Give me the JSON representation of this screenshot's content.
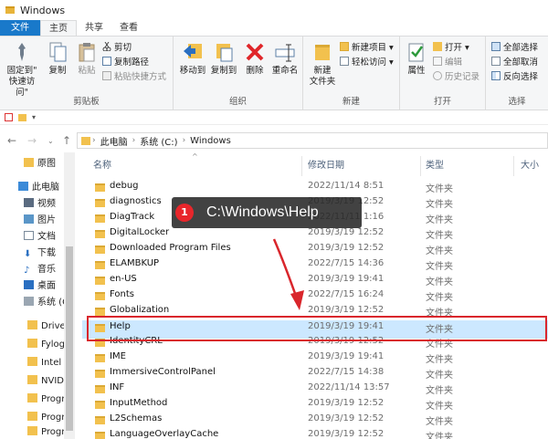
{
  "window": {
    "title": "Windows"
  },
  "ribbon_tabs": [
    "文件",
    "主页",
    "共享",
    "查看"
  ],
  "ribbon": {
    "clipboard": {
      "label": "剪贴板",
      "pin": "固定到\"\n快速访问\"",
      "copy": "复制",
      "paste": "粘贴",
      "cut": "剪切",
      "copy_path": "复制路径",
      "paste_shortcut": "粘贴快捷方式"
    },
    "organize": {
      "label": "组织",
      "move_to": "移动到",
      "copy_to": "复制到",
      "delete": "删除",
      "rename": "重命名"
    },
    "new": {
      "label": "新建",
      "new_folder": "新建\n文件夹",
      "new_item": "新建项目",
      "easy_access": "轻松访问"
    },
    "open": {
      "label": "打开",
      "properties": "属性",
      "open": "打开",
      "edit": "编辑",
      "history": "历史记录"
    },
    "select": {
      "label": "选择",
      "select_all": "全部选择",
      "select_none": "全部取消",
      "invert": "反向选择"
    }
  },
  "address": {
    "crumbs": [
      "此电脑",
      "系统 (C:)",
      "Windows"
    ]
  },
  "nav_items": [
    {
      "label": "原图",
      "icon": "folder-icon"
    },
    {
      "label": "此电脑",
      "icon": "computer-icon"
    },
    {
      "label": "视频",
      "icon": "video-icon"
    },
    {
      "label": "图片",
      "icon": "picture-icon"
    },
    {
      "label": "文档",
      "icon": "document-icon"
    },
    {
      "label": "下载",
      "icon": "download-icon"
    },
    {
      "label": "音乐",
      "icon": "music-icon"
    },
    {
      "label": "桌面",
      "icon": "desktop-icon"
    },
    {
      "label": "系统 (C",
      "icon": "drive-icon"
    },
    {
      "label": "Drive",
      "icon": "folder-icon"
    },
    {
      "label": "Fylog",
      "icon": "folder-icon"
    },
    {
      "label": "Intel",
      "icon": "folder-icon"
    },
    {
      "label": "NVIDI",
      "icon": "folder-icon"
    },
    {
      "label": "Progr",
      "icon": "folder-icon"
    },
    {
      "label": "Progr",
      "icon": "folder-icon"
    },
    {
      "label": "Progr",
      "icon": "folder-icon"
    }
  ],
  "columns": {
    "name": "名称",
    "date": "修改日期",
    "type": "类型",
    "size": "大小"
  },
  "files": [
    {
      "name": "debug",
      "date": "2022/11/14 8:51",
      "type": "文件夹"
    },
    {
      "name": "diagnostics",
      "date": "2019/3/19 12:52",
      "type": "文件夹"
    },
    {
      "name": "DiagTrack",
      "date": "2022/11/11 1:16",
      "type": "文件夹"
    },
    {
      "name": "DigitalLocker",
      "date": "2019/3/19 12:52",
      "type": "文件夹"
    },
    {
      "name": "Downloaded Program Files",
      "date": "2019/3/19 12:52",
      "type": "文件夹"
    },
    {
      "name": "ELAMBKUP",
      "date": "2022/7/15 14:36",
      "type": "文件夹"
    },
    {
      "name": "en-US",
      "date": "2019/3/19 19:41",
      "type": "文件夹"
    },
    {
      "name": "Fonts",
      "date": "2022/7/15 16:24",
      "type": "文件夹"
    },
    {
      "name": "Globalization",
      "date": "2019/3/19 12:52",
      "type": "文件夹"
    },
    {
      "name": "Help",
      "date": "2019/3/19 19:41",
      "type": "文件夹"
    },
    {
      "name": "IdentityCRL",
      "date": "2019/3/19 12:52",
      "type": "文件夹"
    },
    {
      "name": "IME",
      "date": "2019/3/19 19:41",
      "type": "文件夹"
    },
    {
      "name": "ImmersiveControlPanel",
      "date": "2022/7/15 14:38",
      "type": "文件夹"
    },
    {
      "name": "INF",
      "date": "2022/11/14 13:57",
      "type": "文件夹"
    },
    {
      "name": "InputMethod",
      "date": "2019/3/19 12:52",
      "type": "文件夹"
    },
    {
      "name": "L2Schemas",
      "date": "2019/3/19 12:52",
      "type": "文件夹"
    },
    {
      "name": "LanguageOverlayCache",
      "date": "2019/3/19 12:52",
      "type": "文件夹"
    }
  ],
  "selected_file": "Help",
  "callout": {
    "badge": "1",
    "text": "C:\\Windows\\Help"
  },
  "colors": {
    "accent": "#1979ca",
    "highlight": "#d9262c",
    "selected": "#cce8ff",
    "folder": "#f2c14e"
  }
}
